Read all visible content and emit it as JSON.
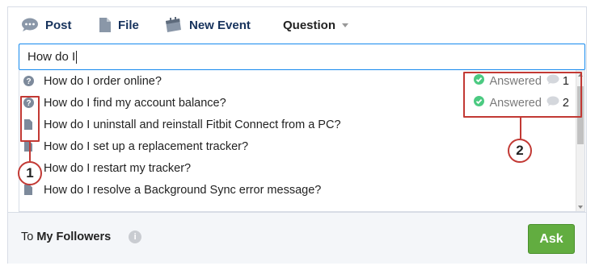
{
  "tabs": {
    "post": "Post",
    "file": "File",
    "event": "New Event",
    "question": "Question"
  },
  "input": {
    "value": "How do I"
  },
  "suggestions": [
    {
      "text": "How do I order online?",
      "icon": "question-icon",
      "status": "Answered",
      "count": "1"
    },
    {
      "text": "How do I find my account balance?",
      "icon": "question-icon",
      "status": "Answered",
      "count": "2"
    },
    {
      "text": "How do I uninstall and reinstall Fitbit Connect from a PC?",
      "icon": "file-icon"
    },
    {
      "text": "How do I set up a replacement tracker?",
      "icon": "file-icon"
    },
    {
      "text": "How do I restart my tracker?",
      "icon": "file-icon"
    },
    {
      "text": "How do I resolve a Background Sync error message?",
      "icon": "file-icon"
    }
  ],
  "footer": {
    "to_label": "To",
    "audience": "My Followers",
    "ask": "Ask"
  },
  "callouts": {
    "one": "1",
    "two": "2"
  },
  "colors": {
    "accent": "#62ad40",
    "callout": "#c23934",
    "link": "#16325c"
  }
}
